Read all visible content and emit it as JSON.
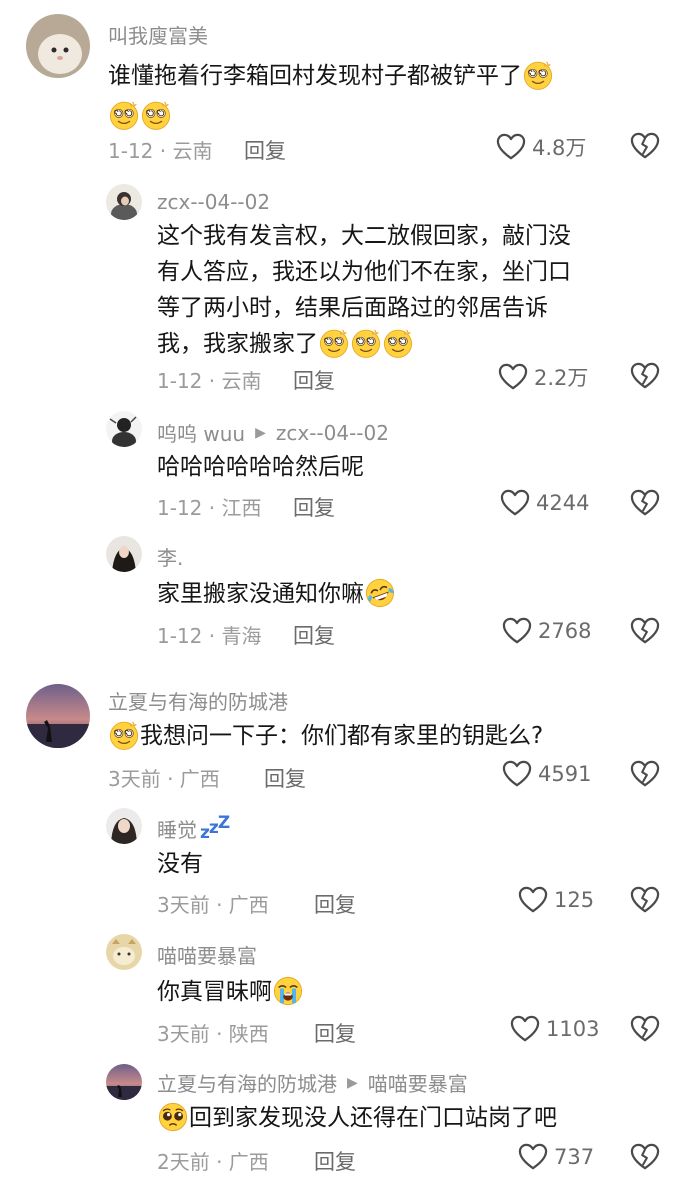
{
  "comments": [
    {
      "username": "叫我廋富美",
      "lines": [
        "谁懂拖着行李箱回村发现村子都被铲平了",
        ""
      ],
      "meta": "1-12 · 云南",
      "reply_label": "回复",
      "likes": "4.8万"
    },
    {
      "username": "zcx--04--02",
      "lines": [
        "这个我有发言权，大二放假回家，敲门没",
        "有人答应，我还以为他们不在家，坐门口",
        "等了两小时，结果后面路过的邻居告诉",
        "我，我家搬家了"
      ],
      "meta": "1-12 · 云南",
      "reply_label": "回复",
      "likes": "2.2万"
    },
    {
      "username": "呜呜 wuu",
      "reply_to": "zcx--04--02",
      "lines": [
        "哈哈哈哈哈哈然后呢"
      ],
      "meta": "1-12 · 江西",
      "reply_label": "回复",
      "likes": "4244"
    },
    {
      "username": "李.",
      "lines": [
        "家里搬家没通知你嘛"
      ],
      "meta": "1-12 · 青海",
      "reply_label": "回复",
      "likes": "2768"
    },
    {
      "username": "立夏与有海的防城港",
      "lines": [
        "我想问一下子：你们都有家里的钥匙么?"
      ],
      "meta": "3天前 · 广西",
      "reply_label": "回复",
      "likes": "4591"
    },
    {
      "username": "睡觉",
      "lines": [
        "没有"
      ],
      "meta": "3天前 · 广西",
      "reply_label": "回复",
      "likes": "125"
    },
    {
      "username": "喵喵要暴富",
      "lines": [
        "你真冒昧啊"
      ],
      "meta": "3天前 · 陕西",
      "reply_label": "回复",
      "likes": "1103"
    },
    {
      "username": "立夏与有海的防城港",
      "reply_to": "喵喵要暴富",
      "lines": [
        "回到家发现没人还得在门口站岗了吧"
      ],
      "meta": "2天前 · 广西",
      "reply_label": "回复",
      "likes": "737"
    }
  ],
  "icons": {
    "like": "heart-outline-icon",
    "dislike": "broken-heart-icon",
    "reply_to": "triangle-right-icon",
    "emoji_dazed": "dizzy-face-emoji",
    "emoji_laugh_cry": "rolling-laughing-emoji",
    "emoji_crying": "loudly-crying-emoji",
    "emoji_pleading": "pleading-face-emoji"
  },
  "colors": {
    "background": "#ffffff",
    "username": "#8d8d8d",
    "text": "#161616",
    "meta": "#9b9b9b",
    "action": "#6b6b6b",
    "zzz_accent": "#3c74d8"
  }
}
